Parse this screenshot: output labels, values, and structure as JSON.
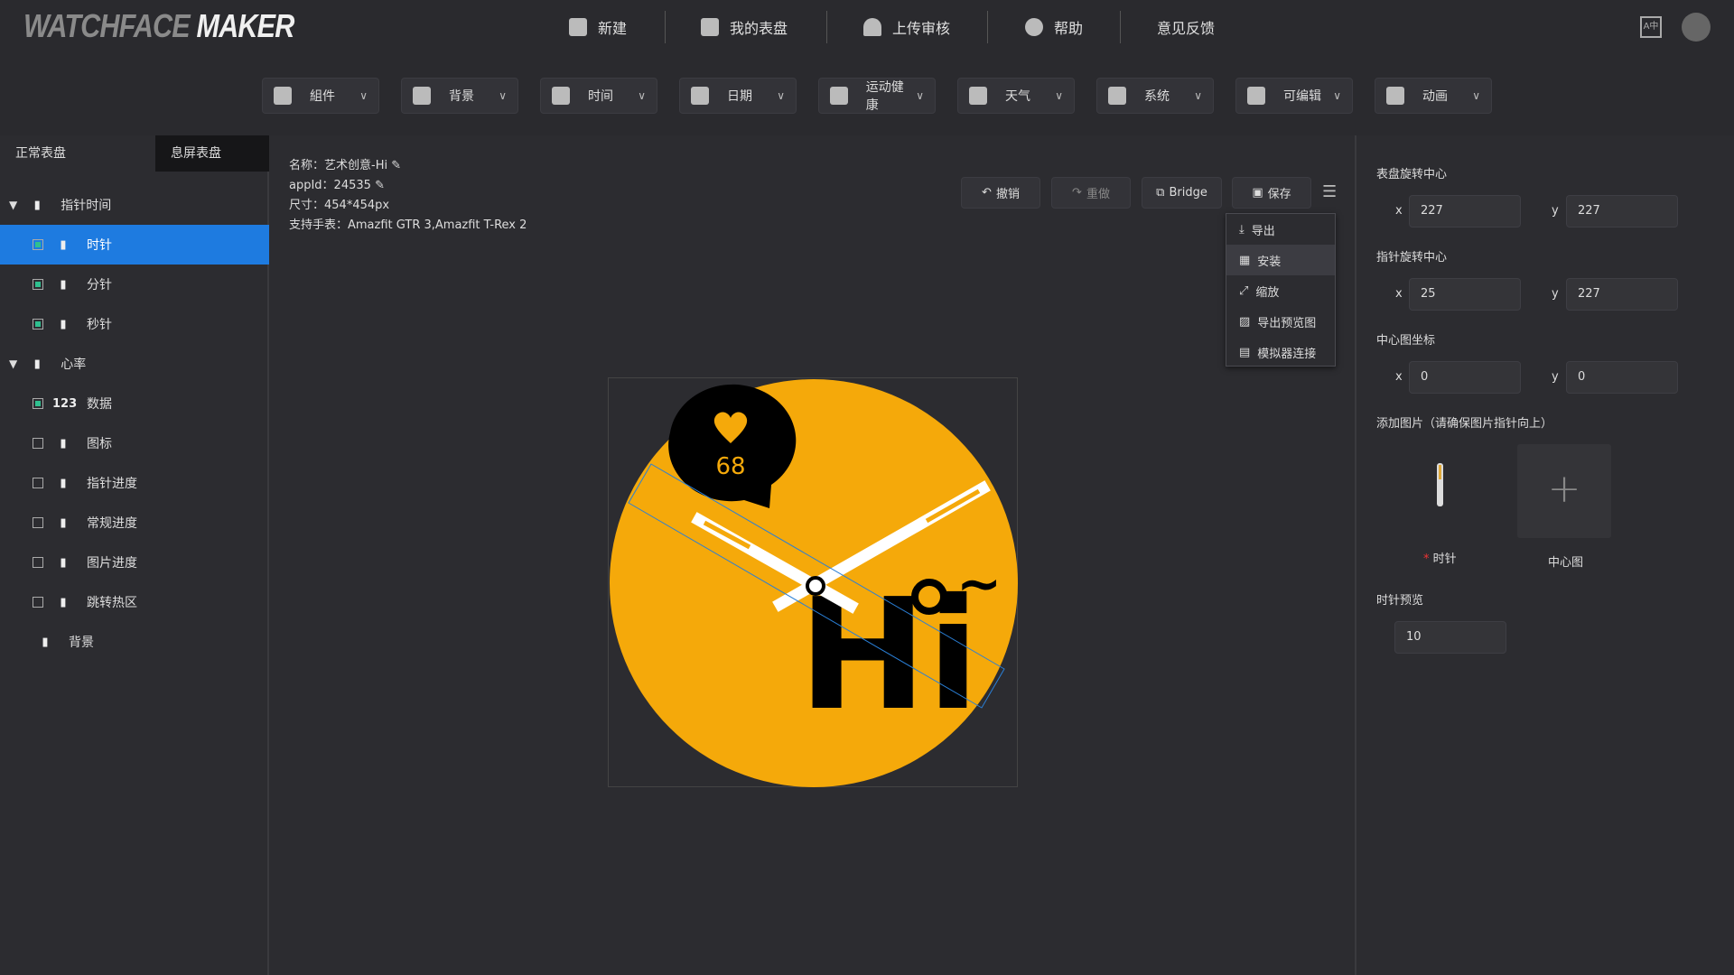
{
  "header": {
    "logo_left": "WATCHFACE",
    "logo_right": "MAKER",
    "nav": [
      {
        "label": "新建",
        "icon": "new-file-icon"
      },
      {
        "label": "我的表盘",
        "icon": "folder-icon"
      },
      {
        "label": "上传审核",
        "icon": "user-icon"
      },
      {
        "label": "帮助",
        "icon": "help-icon"
      },
      {
        "label": "意见反馈"
      }
    ]
  },
  "toolbar": [
    {
      "label": "組件",
      "icon": "widgets-icon"
    },
    {
      "label": "背景",
      "icon": "background-icon"
    },
    {
      "label": "时间",
      "icon": "clock-hand-icon"
    },
    {
      "label": "日期",
      "icon": "calendar-icon"
    },
    {
      "label": "运动健康",
      "icon": "heart-rate-icon"
    },
    {
      "label": "天气",
      "icon": "weather-icon"
    },
    {
      "label": "系统",
      "icon": "system-icon"
    },
    {
      "label": "可编辑",
      "icon": "edit-tools-icon"
    },
    {
      "label": "动画",
      "icon": "animation-icon"
    }
  ],
  "sidebar": {
    "tabs": [
      "正常表盘",
      "息屏表盘"
    ],
    "items": [
      {
        "label": "指针时间",
        "type": "group",
        "icon": "clock-hand-icon"
      },
      {
        "label": "时针",
        "checked": true,
        "selected": true,
        "icon": "hand-icon"
      },
      {
        "label": "分针",
        "checked": true,
        "icon": "hand-icon"
      },
      {
        "label": "秒针",
        "checked": true,
        "icon": "hand-icon"
      },
      {
        "label": "心率",
        "type": "group",
        "icon": "heart-rate-icon"
      },
      {
        "label": "数据",
        "checked": true,
        "icon": "number-icon",
        "glyph": "123"
      },
      {
        "label": "图标",
        "checked": false,
        "icon": "image-icon"
      },
      {
        "label": "指针进度",
        "checked": false,
        "icon": "hand-icon"
      },
      {
        "label": "常规进度",
        "checked": false,
        "icon": "gauge-icon"
      },
      {
        "label": "图片进度",
        "checked": false,
        "icon": "image-icon"
      },
      {
        "label": "跳转热区",
        "checked": false,
        "icon": "hotspot-icon"
      },
      {
        "label": "背景",
        "type": "leaf",
        "icon": "background-icon"
      }
    ]
  },
  "info": {
    "name": "名称：艺术创意-Hi",
    "appid": "appId：24535",
    "size": "尺寸：454*454px",
    "devices": "支持手表：Amazfit GTR 3,Amazfit T-Rex 2"
  },
  "actions": {
    "undo": "撤销",
    "redo": "重做",
    "bridge": "Bridge",
    "save": "保存"
  },
  "menu": [
    {
      "label": "导出",
      "icon": "download-icon"
    },
    {
      "label": "安装",
      "icon": "qr-code-icon"
    },
    {
      "label": "缩放",
      "icon": "resize-icon"
    },
    {
      "label": "导出预览图",
      "icon": "image-icon"
    },
    {
      "label": "模拟器连接",
      "icon": "simulator-icon"
    }
  ],
  "watch": {
    "heart_rate": "68",
    "text": "Hi",
    "tilde": "~",
    "bg_color": "#f5a90a"
  },
  "right": {
    "dial_center": "表盘旋转中心",
    "dial_x": "227",
    "dial_y": "227",
    "hand_center": "指针旋转中心",
    "hand_x": "25",
    "hand_y": "227",
    "center_img": "中心图坐标",
    "center_x": "0",
    "center_y": "0",
    "add_image": "添加图片（请确保图片指针向上）",
    "hour_hand": "时针",
    "center_pic": "中心图",
    "required": "*",
    "preview": "时针预览",
    "preview_value": "10",
    "x": "x",
    "y": "y"
  }
}
